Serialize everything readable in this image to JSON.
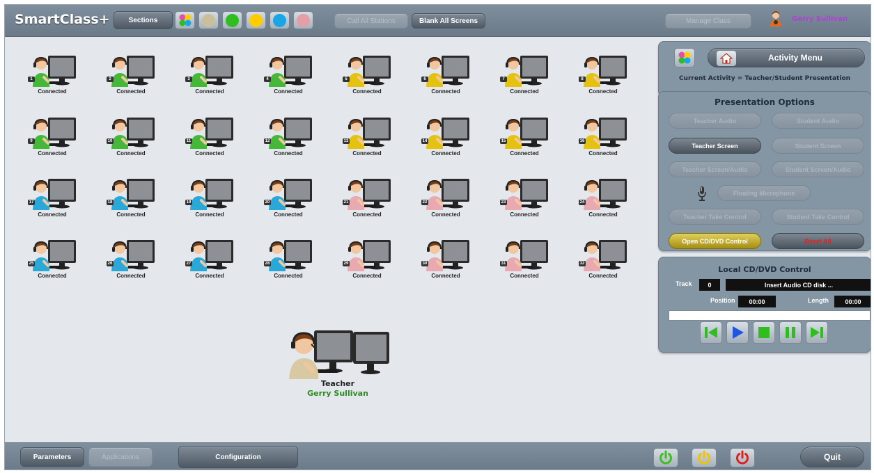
{
  "app": {
    "title": "SmartClass+",
    "user_name": "Gerry Sullivan"
  },
  "toolbar": {
    "sections_label": "Sections",
    "call_all_label": "Call All Stations",
    "blank_all_label": "Blank All Screens",
    "manage_class_label": "Manage Class",
    "section_swatches": [
      {
        "name": "multi",
        "color": "multicolor"
      },
      {
        "name": "tan",
        "color": "#c9bf9a"
      },
      {
        "name": "green",
        "color": "#2fbd1f"
      },
      {
        "name": "yellow",
        "color": "#ffcc00"
      },
      {
        "name": "blue",
        "color": "#1aa5e6"
      },
      {
        "name": "pink",
        "color": "#e39ea7"
      }
    ]
  },
  "stations": [
    {
      "number": "1",
      "status": "Connected",
      "color": "#45b83a"
    },
    {
      "number": "2",
      "status": "Connected",
      "color": "#45b83a"
    },
    {
      "number": "3",
      "status": "Connected",
      "color": "#45b83a"
    },
    {
      "number": "4",
      "status": "Connected",
      "color": "#45b83a"
    },
    {
      "number": "5",
      "status": "Connected",
      "color": "#e5c20f"
    },
    {
      "number": "6",
      "status": "Connected",
      "color": "#e5c20f"
    },
    {
      "number": "7",
      "status": "Connected",
      "color": "#e5c20f"
    },
    {
      "number": "8",
      "status": "Connected",
      "color": "#e5c20f"
    },
    {
      "number": "9",
      "status": "Connected",
      "color": "#45b83a"
    },
    {
      "number": "10",
      "status": "Connected",
      "color": "#45b83a"
    },
    {
      "number": "11",
      "status": "Connected",
      "color": "#45b83a"
    },
    {
      "number": "12",
      "status": "Connected",
      "color": "#45b83a"
    },
    {
      "number": "13",
      "status": "Connected",
      "color": "#e5c20f"
    },
    {
      "number": "14",
      "status": "Connected",
      "color": "#e5c20f"
    },
    {
      "number": "15",
      "status": "Connected",
      "color": "#e5c20f"
    },
    {
      "number": "16",
      "status": "Connected",
      "color": "#e5c20f"
    },
    {
      "number": "17",
      "status": "Connected",
      "color": "#2aa8d8"
    },
    {
      "number": "18",
      "status": "Connected",
      "color": "#2aa8d8"
    },
    {
      "number": "19",
      "status": "Connected",
      "color": "#2aa8d8"
    },
    {
      "number": "20",
      "status": "Connected",
      "color": "#2aa8d8"
    },
    {
      "number": "21",
      "status": "Connected",
      "color": "#e8a9b1"
    },
    {
      "number": "22",
      "status": "Connected",
      "color": "#e8a9b1"
    },
    {
      "number": "23",
      "status": "Connected",
      "color": "#e8a9b1"
    },
    {
      "number": "24",
      "status": "Connected",
      "color": "#e8a9b1"
    },
    {
      "number": "25",
      "status": "Connected",
      "color": "#2aa8d8"
    },
    {
      "number": "26",
      "status": "Connected",
      "color": "#2aa8d8"
    },
    {
      "number": "27",
      "status": "Connected",
      "color": "#2aa8d8"
    },
    {
      "number": "28",
      "status": "Connected",
      "color": "#2aa8d8"
    },
    {
      "number": "29",
      "status": "Connected",
      "color": "#e8a9b1"
    },
    {
      "number": "30",
      "status": "Connected",
      "color": "#e8a9b1"
    },
    {
      "number": "31",
      "status": "Connected",
      "color": "#e8a9b1"
    },
    {
      "number": "32",
      "status": "Connected",
      "color": "#e8a9b1"
    }
  ],
  "teacher": {
    "label": "Teacher",
    "name": "Gerry Sullivan"
  },
  "activity": {
    "menu_label": "Activity Menu",
    "current": "Current Activity = Teacher/Student Presentation"
  },
  "presentation": {
    "title": "Presentation Options",
    "teacher_audio": "Teacher Audio",
    "student_audio": "Student Audio",
    "teacher_screen": "Teacher Screen",
    "student_screen": "Student Screen",
    "teacher_screen_audio": "Teacher Screen/Audio",
    "student_screen_audio": "Student Screen/Audio",
    "floating_mic": "Floating Microphone",
    "teacher_take_control": "Teacher Take Control",
    "student_take_control": "Student Take Control",
    "open_cd": "Open CD/DVD Control",
    "reset_all": "Reset All"
  },
  "cd": {
    "title": "Local CD/DVD Control",
    "track_label": "Track",
    "track_value": "0",
    "disc_status": "Insert Audio CD disk ...",
    "position_label": "Position",
    "position_value": "00:00",
    "length_label": "Length",
    "length_value": "00:00"
  },
  "bottom": {
    "parameters_label": "Parameters",
    "applications_label": "Applications",
    "configuration_label": "Configuration",
    "quit_label": "Quit",
    "power_colors": [
      "#3fbf1f",
      "#f0c300",
      "#e02020"
    ]
  }
}
